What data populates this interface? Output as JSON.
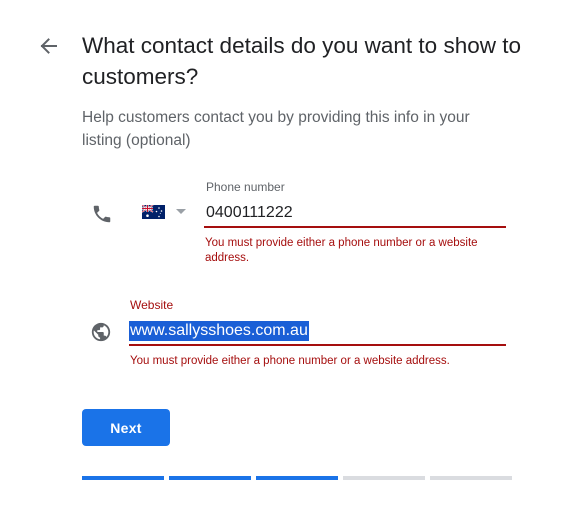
{
  "header": {
    "back_icon": "arrow-back-icon",
    "title": "What contact details do you want to show to customers?",
    "subtitle": "Help customers contact you by providing this info in your listing (optional)"
  },
  "phone": {
    "icon": "phone-icon",
    "country_flag": "australia-flag-icon",
    "label": "Phone number",
    "value": "0400111222",
    "error": "You must provide either a phone number or a website address."
  },
  "website": {
    "icon": "globe-icon",
    "label": "Website",
    "value": "www.sallysshoes.com.au",
    "error": "You must provide either a phone number or a website address."
  },
  "actions": {
    "next_label": "Next"
  },
  "progress": {
    "total_steps": 5,
    "completed_steps": 3,
    "active_color": "#1a73e8",
    "inactive_color": "#dadce0"
  },
  "colors": {
    "error": "#a50e0e",
    "primary": "#1a73e8",
    "text": "#202124",
    "secondary_text": "#5f6368"
  }
}
